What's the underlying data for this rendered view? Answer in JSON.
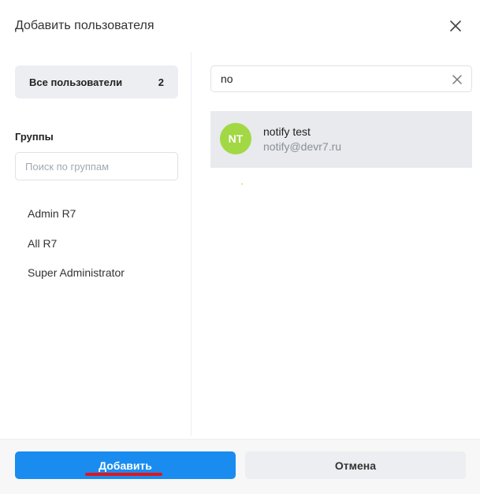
{
  "header": {
    "title": "Добавить пользователя"
  },
  "sidebar": {
    "all_users": {
      "label": "Все пользователи",
      "count": "2"
    },
    "groups_heading": "Группы",
    "group_search_placeholder": "Поиск по группам",
    "groups": [
      "Admin R7",
      "All R7",
      "Super Administrator"
    ]
  },
  "main": {
    "search_value": "no",
    "results": [
      {
        "initials": "NT",
        "name": "notify test",
        "email": "notify@devr7.ru",
        "avatar_color": "#a1d844"
      }
    ]
  },
  "footer": {
    "add_label": "Добавить",
    "cancel_label": "Отмена"
  },
  "colors": {
    "accent": "#1a8cf0",
    "annotation": "#e0151f",
    "selected_row": "#e8eaed"
  }
}
